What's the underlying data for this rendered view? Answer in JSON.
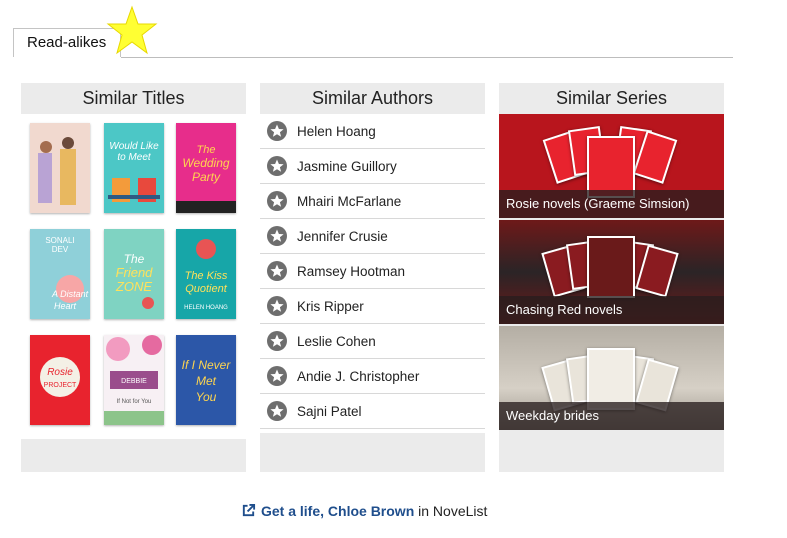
{
  "tab": {
    "label": "Read-alikes"
  },
  "columns": {
    "titles": {
      "header": "Similar Titles"
    },
    "authors": {
      "header": "Similar Authors",
      "items": [
        "Helen Hoang",
        "Jasmine Guillory",
        "Mhairi McFarlane",
        "Jennifer Crusie",
        "Ramsey Hootman",
        "Kris Ripper",
        "Leslie Cohen",
        "Andie J. Christopher",
        "Sajni Patel"
      ]
    },
    "series": {
      "header": "Similar Series",
      "items": [
        "Rosie novels (Graeme Simsion)",
        "Chasing Red novels",
        "Weekday brides"
      ]
    }
  },
  "footer": {
    "link_text": "Get a life, Chloe Brown",
    "suffix": " in NoveList"
  },
  "colors": {
    "link": "#1f4e8c",
    "column_bg": "#ebebeb",
    "icon": "#6e6e6e"
  }
}
